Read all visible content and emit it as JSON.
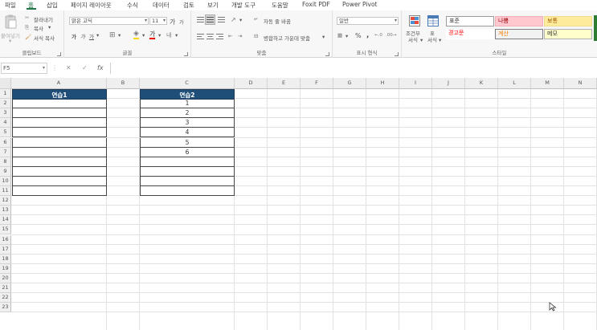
{
  "ribbon_tabs": [
    "파일",
    "홈",
    "삽입",
    "페이지 레이아웃",
    "수식",
    "데이터",
    "검토",
    "보기",
    "개발 도구",
    "도움말",
    "Foxit PDF",
    "Power Pivot"
  ],
  "clipboard": {
    "paste": "붙여넣기",
    "cut": "잘라내기",
    "copy": "복사",
    "format_painter": "서식 복사",
    "label": "클립보드"
  },
  "font": {
    "name": "맑은 고딕",
    "size": "11",
    "bold": "가",
    "italic": "가",
    "underline": "가",
    "grow": "가",
    "shrink": "가",
    "label": "글꼴"
  },
  "alignment": {
    "wrap": "자동 줄 바꿈",
    "merge": "병합하고 가운데 맞춤",
    "label": "맞춤"
  },
  "number": {
    "format": "일반",
    "label": "표시 형식"
  },
  "styles": {
    "conditional": "조건부\n서식",
    "as_table": "표\n서식",
    "normal": "표준",
    "bad": "나쁨",
    "neutral": "보통",
    "warning": "경고문",
    "calculation": "계산",
    "note": "메모",
    "label": "스타일",
    "colors": {
      "bad_bg": "#ffc7ce",
      "bad_text": "#9c0006",
      "neutral_bg": "#ffeb9c",
      "neutral_text": "#9c5700",
      "note_bg": "#ffffcc",
      "calc_bg": "#f2f2f2",
      "calc_text": "#fa7d00",
      "warning_text": "#ff0000"
    }
  },
  "formula_bar": {
    "name_box": "F5",
    "cancel": "✕",
    "enter": "✓",
    "fx": "fx",
    "value": ""
  },
  "columns": [
    "A",
    "B",
    "C",
    "D",
    "E",
    "F",
    "G",
    "H",
    "I",
    "J",
    "K",
    "L",
    "M",
    "N"
  ],
  "rows": [
    "1",
    "2",
    "3",
    "4",
    "5",
    "6",
    "7",
    "8",
    "9",
    "10",
    "11",
    "12",
    "13",
    "14",
    "15",
    "16",
    "17",
    "18",
    "19",
    "20",
    "21",
    "22",
    "23"
  ],
  "table1": {
    "header": "연습1",
    "values": [
      "",
      "",
      "",
      "",
      "",
      "",
      "",
      "",
      "",
      ""
    ]
  },
  "table2": {
    "header": "연습2",
    "values": [
      "1",
      "2",
      "3",
      "4",
      "5",
      "6",
      "",
      "",
      "",
      ""
    ]
  },
  "accent": "#217346",
  "table_header_color": "#1f4e79"
}
